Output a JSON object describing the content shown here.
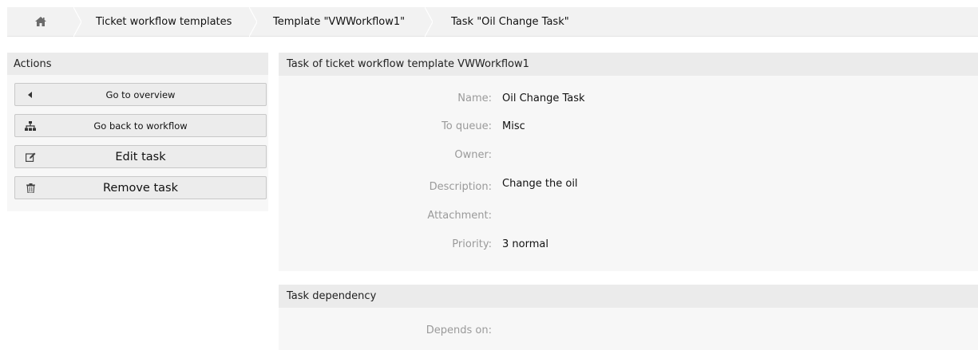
{
  "breadcrumb": {
    "home_icon": "home-icon",
    "items": [
      {
        "label": "Ticket workflow templates"
      },
      {
        "label": "Template \"VWWorkflow1\""
      },
      {
        "label": "Task \"Oil Change Task\""
      }
    ]
  },
  "actions": {
    "title": "Actions",
    "buttons": [
      {
        "label": "Go to overview",
        "icon": "caret-left-icon"
      },
      {
        "label": "Go back to workflow",
        "icon": "sitemap-icon"
      },
      {
        "label": "Edit task",
        "icon": "edit-icon"
      },
      {
        "label": "Remove task",
        "icon": "trash-icon"
      }
    ]
  },
  "task_panel": {
    "title": "Task of ticket workflow template VWWorkflow1",
    "fields": [
      {
        "label": "Name:",
        "value": "Oil Change Task"
      },
      {
        "label": "To queue:",
        "value": "Misc"
      },
      {
        "label": "Owner:",
        "value": ""
      },
      {
        "label": "Description:",
        "value": "Change the oil"
      },
      {
        "label": "Attachment:",
        "value": ""
      },
      {
        "label": "Priority:",
        "value": "3 normal"
      }
    ]
  },
  "dependency_panel": {
    "title": "Task dependency",
    "fields": [
      {
        "label": "Depends on:",
        "value": ""
      }
    ]
  },
  "colors": {
    "panel_bg": "#f7f7f7",
    "header_bg": "#ebebeb",
    "label": "#9a9a9a",
    "button_bg": "#ececec"
  }
}
